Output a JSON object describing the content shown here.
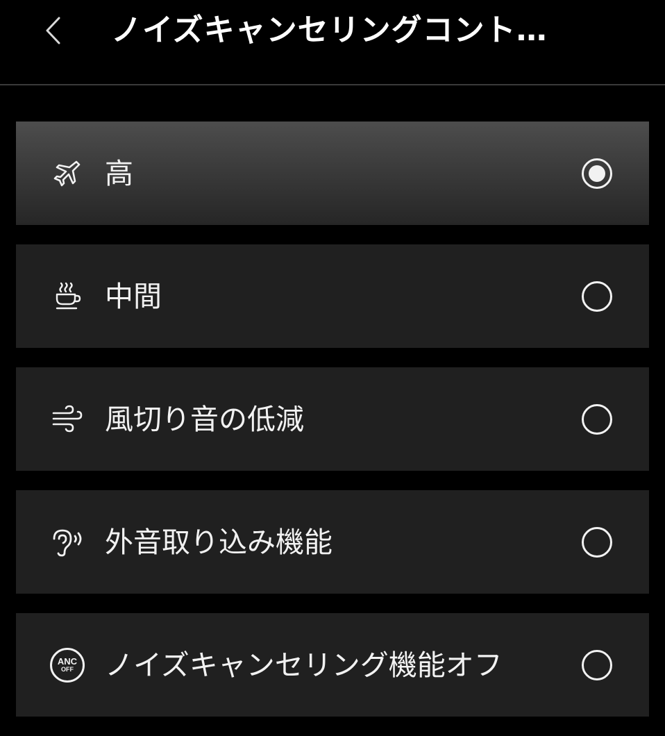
{
  "header": {
    "title": "ノイズキャンセリングコント…",
    "back_icon": "chevron-left-icon"
  },
  "options": [
    {
      "label": "高",
      "icon": "airplane-icon",
      "selected": true
    },
    {
      "label": "中間",
      "icon": "coffee-cup-icon",
      "selected": false
    },
    {
      "label": "風切り音の低減",
      "icon": "wind-icon",
      "selected": false
    },
    {
      "label": "外音取り込み機能",
      "icon": "ear-sound-icon",
      "selected": false
    },
    {
      "label": "ノイズキャンセリング機能オフ",
      "icon": "anc-off-icon",
      "selected": false
    }
  ],
  "anc_badge": {
    "top": "ANC",
    "bottom": "OFF"
  },
  "colors": {
    "background": "#000000",
    "row": "#202020",
    "row_selected": "#4d4d4d",
    "foreground": "#f2f2f2"
  }
}
